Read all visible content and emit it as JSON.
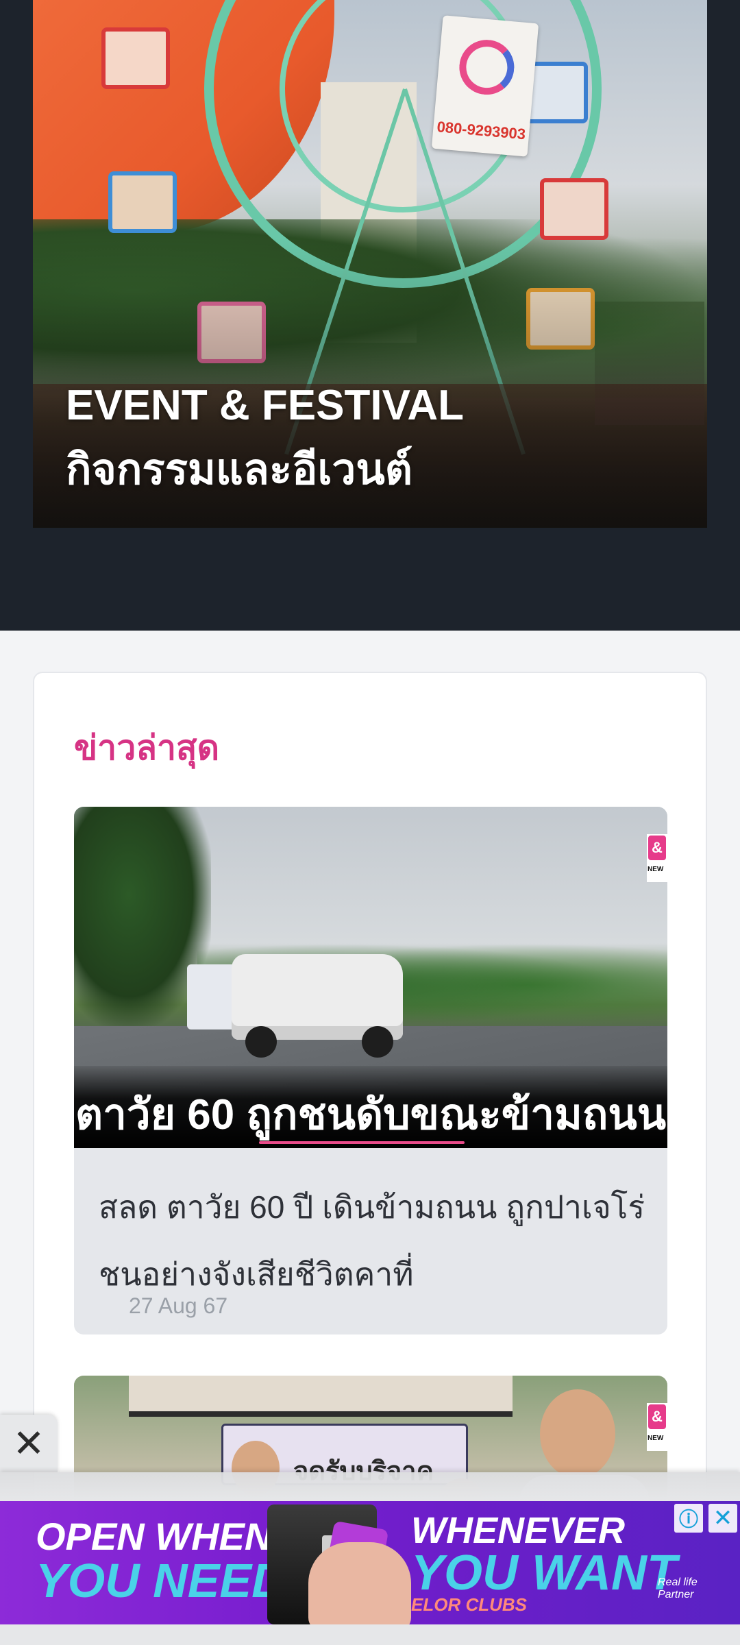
{
  "hero": {
    "title_en": "EVENT & FESTIVAL",
    "title_th": "กิจกรรมและอีเวนต์",
    "sign_phone": "080-9293903"
  },
  "latest_news": {
    "section_title": "ข่าวล่าสุด",
    "articles": [
      {
        "thumbnail_caption": "ตาวัย 60 ถูกชนดับขณะข้ามถนน",
        "title_line1": "สลด ตาวัย 60 ปี เดินข้ามถนน ถูกปาเจโร่",
        "title_line2": "ชนอย่างจังเสียชีวิตคาที่",
        "date": "27 Aug 67",
        "brand_label": "NEW"
      },
      {
        "thumbnail_caption": "จดรับบริจาค",
        "brand_label": "NEW"
      }
    ]
  },
  "ad": {
    "left_line1": "OPEN WHEN",
    "left_line2": "YOU NEED US",
    "right_line1": "WHENEVER",
    "right_line2": "YOU WANT",
    "right_line3": "ELOR CLUBS",
    "signature": "Real life Partner",
    "info_icon": "info-icon",
    "close_icon": "close-icon",
    "dismiss_icon": "close-icon"
  },
  "colors": {
    "dark_bg": "#1d232c",
    "accent_pink": "#d63384",
    "card_gray": "#e5e7eb",
    "ad_purple": "#7a1fd0"
  }
}
